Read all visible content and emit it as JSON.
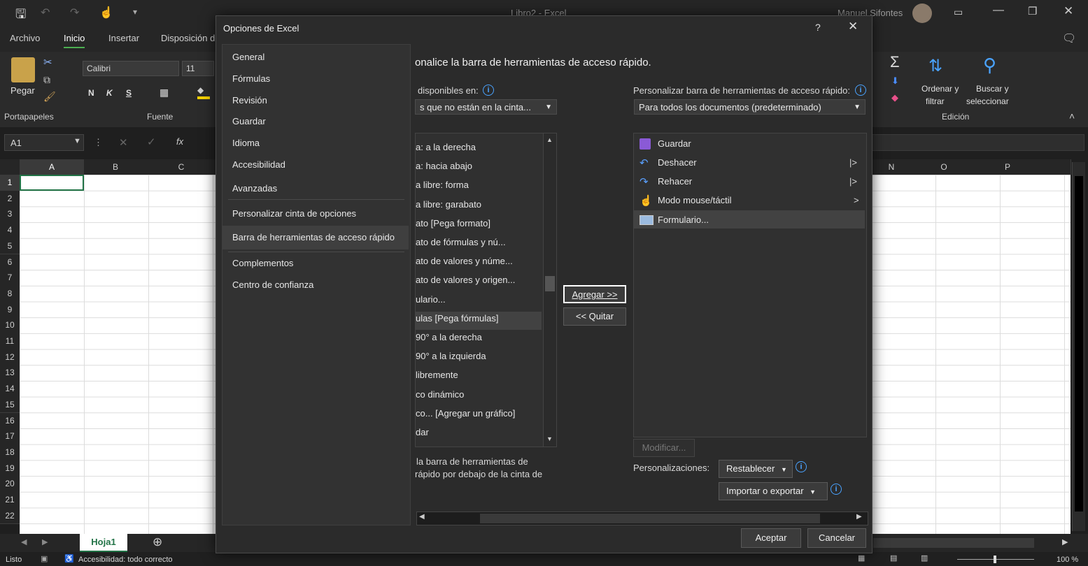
{
  "window": {
    "title": "Libro2 - Excel",
    "user": "Manuel Sifontes"
  },
  "ribbon_tabs": [
    "Archivo",
    "Inicio",
    "Insertar",
    "Disposición de"
  ],
  "ribbon": {
    "paste_label": "Pegar",
    "clipboard_group": "Portapapeles",
    "font_name": "Calibri",
    "font_size": "11",
    "bold": "N",
    "italic": "K",
    "underline": "S",
    "font_group": "Fuente",
    "sort_label_1": "Ordenar y",
    "sort_label_2": "filtrar",
    "find_label_1": "Buscar y",
    "find_label_2": "seleccionar",
    "editing_group": "Edición"
  },
  "formula_bar": {
    "name_box": "A1",
    "fx": "fx"
  },
  "grid": {
    "columns_left": [
      "A",
      "B",
      "C"
    ],
    "columns_right": [
      "N",
      "O",
      "P"
    ],
    "rows": [
      "1",
      "2",
      "3",
      "4",
      "5",
      "6",
      "7",
      "8",
      "9",
      "10",
      "11",
      "12",
      "13",
      "14",
      "15",
      "16",
      "17",
      "18",
      "19",
      "20",
      "21",
      "22"
    ]
  },
  "sheet_tab": "Hoja1",
  "status": {
    "ready": "Listo",
    "accessibility": "Accesibilidad: todo correcto",
    "zoom": "100 %"
  },
  "dialog": {
    "title": "Opciones de Excel",
    "help": "?",
    "close": "✕",
    "nav": {
      "items": [
        "General",
        "Fórmulas",
        "Revisión",
        "Guardar",
        "Idioma",
        "Accesibilidad",
        "Avanzadas",
        "Personalizar cinta de opciones",
        "Barra de herramientas de acceso rápido",
        "Complementos",
        "Centro de confianza"
      ],
      "selected": "Barra de herramientas de acceso rápido"
    },
    "heading": "onalice la barra de herramientas de acceso rápido.",
    "left_label": "disponibles en:",
    "left_dropdown": "s que no están en la cinta...",
    "left_commands": [
      "a: a la derecha",
      "a: hacia abajo",
      "a libre: forma",
      "a libre: garabato",
      "ato [Pega formato]",
      "ato de fórmulas y nú...",
      "ato de valores y núme...",
      "ato de valores y origen...",
      "ulario...",
      "ulas [Pega fórmulas]",
      "90° a la derecha",
      "90° a la izquierda",
      "libremente",
      "co dinámico",
      "co... [Agregar un gráfico]",
      "dar"
    ],
    "left_selected_index": 9,
    "add_button": "Agregar >>",
    "remove_button": "<< Quitar",
    "right_label": "Personalizar barra de herramientas de acceso rápido:",
    "right_dropdown": "Para todos los documentos (predeterminado)",
    "right_commands": [
      {
        "label": "Guardar",
        "icon": "save-icon",
        "arrow": ""
      },
      {
        "label": "Deshacer",
        "icon": "undo-icon",
        "arrow": "|>"
      },
      {
        "label": "Rehacer",
        "icon": "redo-icon",
        "arrow": "|>"
      },
      {
        "label": "Modo mouse/táctil",
        "icon": "touch-mode-icon",
        "arrow": ">"
      },
      {
        "label": "Formulario...",
        "icon": "form-icon",
        "arrow": ""
      }
    ],
    "right_selected_index": 4,
    "modify_button": "Modificar...",
    "customizations_label": "Personalizaciones:",
    "reset_button": "Restablecer",
    "import_export_button": "Importar o exportar",
    "below_ribbon_line1": "la barra de herramientas de",
    "below_ribbon_line2": "rápido por debajo de la cinta de",
    "ok_button": "Aceptar",
    "cancel_button": "Cancelar"
  }
}
